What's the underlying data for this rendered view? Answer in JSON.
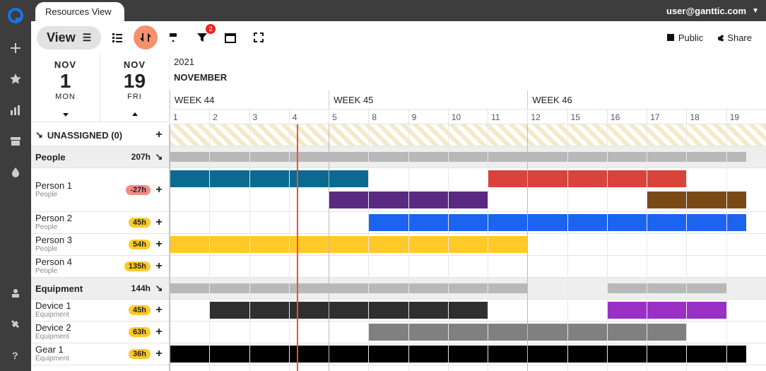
{
  "header": {
    "tab_title": "Resources View",
    "user": "user@ganttic.com"
  },
  "toolbar": {
    "view_label": "View",
    "filter_badge": "2",
    "public_label": "Public",
    "share_label": "Share"
  },
  "daterange": {
    "start": {
      "month": "NOV",
      "day": "1",
      "weekday": "MON"
    },
    "end": {
      "month": "NOV",
      "day": "19",
      "weekday": "FRI"
    },
    "year": "2021",
    "month_name": "NOVEMBER",
    "weeks": [
      "WEEK 44",
      "WEEK 45",
      "WEEK 46"
    ],
    "days": [
      "1",
      "2",
      "3",
      "4",
      "5",
      "8",
      "9",
      "10",
      "11",
      "12",
      "15",
      "16",
      "17",
      "18",
      "19"
    ]
  },
  "rows": {
    "unassigned": {
      "label": "UNASSIGNED (0)"
    },
    "groups": [
      {
        "name": "People",
        "hours": "207h"
      },
      {
        "name": "Equipment",
        "hours": "144h"
      }
    ],
    "resources": [
      {
        "name": "Person 1",
        "sub": "People",
        "hours": "-27h",
        "neg": true
      },
      {
        "name": "Person 2",
        "sub": "People",
        "hours": "45h"
      },
      {
        "name": "Person 3",
        "sub": "People",
        "hours": "54h"
      },
      {
        "name": "Person 4",
        "sub": "People",
        "hours": "135h"
      },
      {
        "name": "Device 1",
        "sub": "Equipment",
        "hours": "45h"
      },
      {
        "name": "Device 2",
        "sub": "Equipment",
        "hours": "63h"
      },
      {
        "name": "Gear 1",
        "sub": "Equipment",
        "hours": "36h"
      }
    ]
  },
  "chart_data": {
    "type": "gantt",
    "x_unit": "weekday",
    "x_range": [
      1,
      19
    ],
    "now_marker": 4.2,
    "week_boundaries": [
      1,
      5,
      12
    ],
    "tasks": [
      {
        "resource": "Person 1",
        "start": 1,
        "end": 8,
        "color": "#0b6a8f",
        "lane": 0
      },
      {
        "resource": "Person 1",
        "start": 5,
        "end": 11,
        "color": "#5a2a82",
        "lane": 1
      },
      {
        "resource": "Person 1",
        "start": 11,
        "end": 18,
        "color": "#d9433b",
        "lane": 0
      },
      {
        "resource": "Person 1",
        "start": 17,
        "end": 19.5,
        "color": "#7a4a16",
        "lane": 1
      },
      {
        "resource": "Person 2",
        "start": 8,
        "end": 19.5,
        "color": "#1a64ef"
      },
      {
        "resource": "Person 3",
        "start": 1,
        "end": 12,
        "color": "#ffc928"
      },
      {
        "resource": "Device 1",
        "start": 2,
        "end": 11,
        "color": "#2f2f2f"
      },
      {
        "resource": "Device 1",
        "start": 16,
        "end": 19,
        "color": "#9a2fc4"
      },
      {
        "resource": "Device 2",
        "start": 8,
        "end": 18,
        "color": "#808080"
      },
      {
        "resource": "Gear 1",
        "start": 1,
        "end": 19.5,
        "color": "#000000"
      }
    ],
    "group_bars": [
      {
        "group": "People",
        "segments": [
          [
            1,
            8
          ],
          [
            8,
            12
          ],
          [
            11,
            19.5
          ]
        ]
      },
      {
        "group": "Equipment",
        "segments": [
          [
            1,
            4
          ],
          [
            2,
            8
          ],
          [
            8,
            11
          ],
          [
            11,
            12
          ],
          [
            16,
            18
          ],
          [
            18,
            19
          ]
        ]
      }
    ]
  }
}
